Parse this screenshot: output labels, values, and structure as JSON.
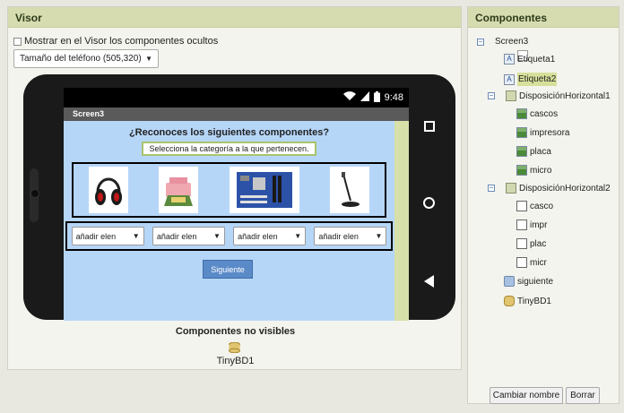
{
  "visor": {
    "header": "Visor",
    "show_hidden_label": "Mostrar en el Visor los componentes ocultos",
    "phone_size": "Tamaño del teléfono (505,320)",
    "status_time": "9:48",
    "app": {
      "screen_title": "Screen3",
      "question": "¿Reconoces los siguientes componentes?",
      "instruction": "Selecciona la categoría a la que pertenecen.",
      "selects": [
        "añadir elen",
        "añadir elen",
        "añadir elen",
        "añadir elen"
      ],
      "next_button": "Siguiente"
    },
    "nonvisible_title": "Componentes no visibles",
    "nonvisible_item": "TinyBD1"
  },
  "components": {
    "header": "Componentes",
    "tree": {
      "screen": "Screen3",
      "etiqueta1": "Etiqueta1",
      "etiqueta2": "Etiqueta2",
      "hz1": "DisposiciónHorizontal1",
      "cascos": "cascos",
      "impresora": "impresora",
      "placa": "placa",
      "micro": "micro",
      "hz2": "DisposiciónHorizontal2",
      "casco": "casco",
      "impr": "impr",
      "plac": "plac",
      "micr": "micr",
      "siguiente": "siguiente",
      "tinydb": "TinyBD1"
    },
    "rename_button": "Cambiar nombre",
    "delete_button": "Borrar"
  }
}
